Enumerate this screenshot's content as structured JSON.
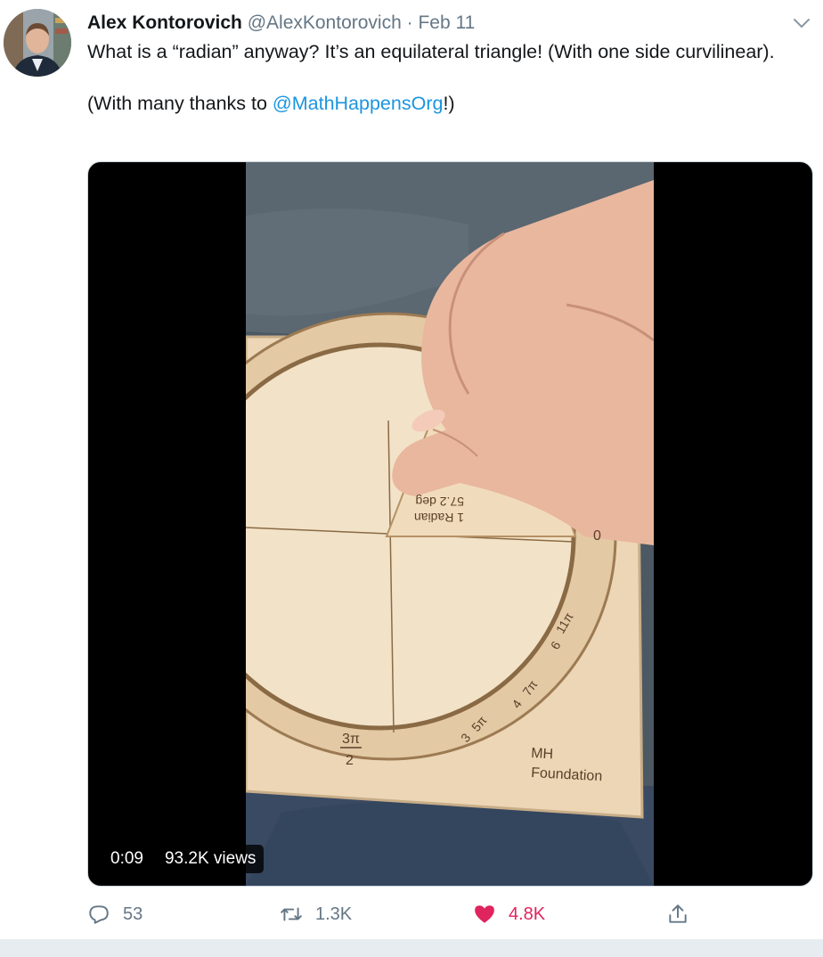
{
  "tweet": {
    "author_name": "Alex Kontorovich",
    "author_handle": "@AlexKontorovich",
    "separator": "·",
    "date": "Feb 11",
    "text_line1": "What is a “radian” anyway? It’s an equilateral triangle! (With one side curvilinear).",
    "text_line2_prefix": "(With many thanks to ",
    "mention": "@MathHappensOrg",
    "text_line2_suffix": "!)"
  },
  "video": {
    "timestamp": "0:09",
    "views": "93.2K views",
    "board_labels": {
      "radian": "1 Radian",
      "degrees": "57.2 deg",
      "zero": "0",
      "eleven_pi_num": "11π",
      "eleven_pi_den": "6",
      "seven_pi_num": "7π",
      "seven_pi_den": "4",
      "five_pi_num": "5π",
      "five_pi_den": "3",
      "three_pi_num": "3π",
      "three_pi_den": "2",
      "foundation_line1": "MH",
      "foundation_line2": "Foundation"
    }
  },
  "actions": {
    "replies": "53",
    "retweets": "1.3K",
    "likes": "4.8K"
  },
  "icons": {
    "reply": "reply-icon",
    "retweet": "retweet-icon",
    "like": "heart-icon",
    "share": "share-icon",
    "menu": "chevron-down-icon"
  },
  "colors": {
    "link": "#1b95e0",
    "like": "#e0245e",
    "muted": "#657786"
  }
}
